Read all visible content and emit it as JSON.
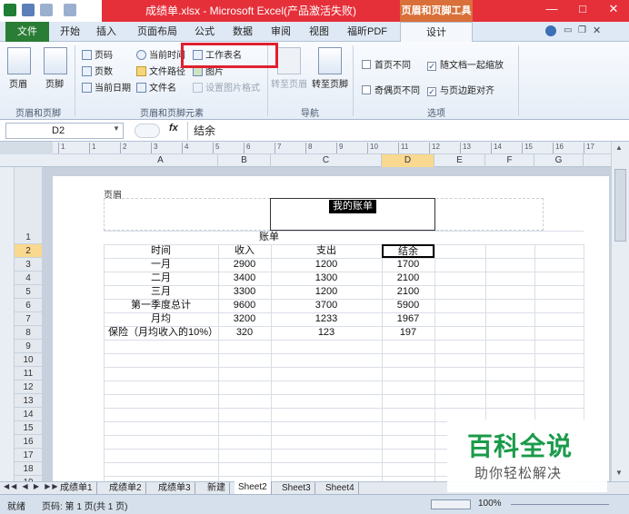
{
  "window": {
    "title": "成绩单.xlsx - Microsoft Excel(产品激活失败)",
    "context_tool": "页眉和页脚工具",
    "controls": {
      "min": "—",
      "max": "□",
      "close": "✕"
    }
  },
  "tabs": [
    "文件",
    "开始",
    "插入",
    "页面布局",
    "公式",
    "数据",
    "审阅",
    "视图",
    "福昕PDF",
    "设计"
  ],
  "ribbon": {
    "group1": {
      "label": "页眉和页脚",
      "header": "页眉",
      "footer": "页脚"
    },
    "group2": {
      "label": "页眉和页脚元素",
      "items": [
        "页码",
        "页数",
        "当前日期",
        "当前时间",
        "文件路径",
        "文件名",
        "工作表名",
        "图片",
        "设置图片格式"
      ]
    },
    "group3": {
      "label": "导航",
      "goto_header": "转至页眉",
      "goto_footer": "转至页脚"
    },
    "group4": {
      "label": "选项",
      "opts": [
        "首页不同",
        "随文档一起缩放",
        "奇偶页不同",
        "与页边距对齐"
      ],
      "checked": [
        false,
        true,
        false,
        true
      ]
    }
  },
  "formula_bar": {
    "name_box": "D2",
    "fx": "fx",
    "value": "结余"
  },
  "ruler_ticks": [
    "1",
    "1",
    "2",
    "3",
    "4",
    "5",
    "6",
    "7",
    "8",
    "9",
    "10",
    "11",
    "12",
    "13",
    "14",
    "15",
    "16",
    "17"
  ],
  "columns": [
    "A",
    "B",
    "C",
    "D",
    "E",
    "F",
    "G"
  ],
  "selected_column": "D",
  "rows": [
    "1",
    "2",
    "3",
    "4",
    "5",
    "6",
    "7",
    "8",
    "9",
    "10",
    "11",
    "12",
    "13",
    "14",
    "15",
    "16",
    "17",
    "18",
    "19"
  ],
  "selected_row": "2",
  "page": {
    "header_label": "页眉",
    "header_content": "我的账单",
    "sheet": {
      "title": "账单",
      "headers": [
        "时间",
        "收入",
        "支出",
        "结余"
      ],
      "data": [
        [
          "一月",
          "2900",
          "1200",
          "1700"
        ],
        [
          "二月",
          "3400",
          "1300",
          "2100"
        ],
        [
          "三月",
          "3300",
          "1200",
          "2100"
        ],
        [
          "第一季度总计",
          "9600",
          "3700",
          "5900"
        ],
        [
          "月均",
          "3200",
          "1233",
          "1967"
        ],
        [
          "保险（月均收入的10%）",
          "320",
          "123",
          "197"
        ]
      ]
    }
  },
  "sheet_tabs": [
    "成绩单1",
    "成绩单2",
    "成绩单3",
    "新建",
    "Sheet2",
    "Sheet3",
    "Sheet4"
  ],
  "active_sheet": "Sheet2",
  "status": {
    "ready": "就绪",
    "page": "页码: 第 1 页(共 1 页)",
    "zoom": "100%"
  },
  "watermark": {
    "title": "百科全说",
    "subtitle": "助你轻松解决"
  }
}
